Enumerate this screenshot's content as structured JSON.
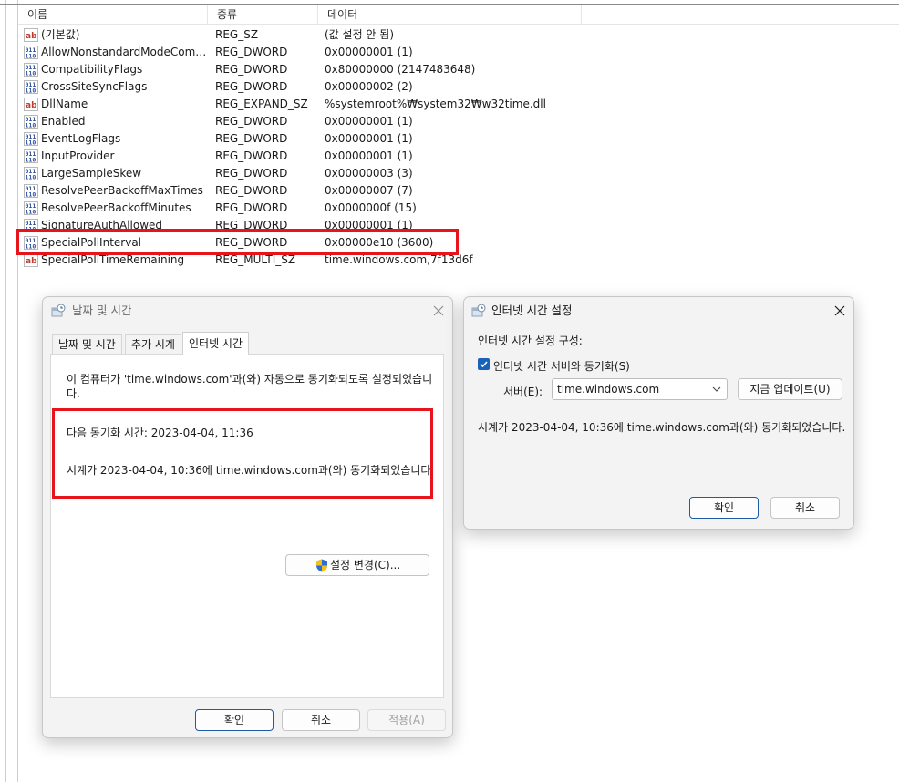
{
  "registry": {
    "columns": {
      "name": "이름",
      "type": "종류",
      "data": "데이터"
    },
    "rows": [
      {
        "icon": "string-value-icon",
        "name": "(기본값)",
        "type": "REG_SZ",
        "data": "(값 설정 안 됨)"
      },
      {
        "icon": "binary-value-icon",
        "name": "AllowNonstandardModeCombin...",
        "type": "REG_DWORD",
        "data": "0x00000001 (1)"
      },
      {
        "icon": "binary-value-icon",
        "name": "CompatibilityFlags",
        "type": "REG_DWORD",
        "data": "0x80000000 (2147483648)"
      },
      {
        "icon": "binary-value-icon",
        "name": "CrossSiteSyncFlags",
        "type": "REG_DWORD",
        "data": "0x00000002 (2)"
      },
      {
        "icon": "string-value-icon",
        "name": "DllName",
        "type": "REG_EXPAND_SZ",
        "data": "%systemroot%₩system32₩w32time.dll"
      },
      {
        "icon": "binary-value-icon",
        "name": "Enabled",
        "type": "REG_DWORD",
        "data": "0x00000001 (1)"
      },
      {
        "icon": "binary-value-icon",
        "name": "EventLogFlags",
        "type": "REG_DWORD",
        "data": "0x00000001 (1)"
      },
      {
        "icon": "binary-value-icon",
        "name": "InputProvider",
        "type": "REG_DWORD",
        "data": "0x00000001 (1)"
      },
      {
        "icon": "binary-value-icon",
        "name": "LargeSampleSkew",
        "type": "REG_DWORD",
        "data": "0x00000003 (3)"
      },
      {
        "icon": "binary-value-icon",
        "name": "ResolvePeerBackoffMaxTimes",
        "type": "REG_DWORD",
        "data": "0x00000007 (7)"
      },
      {
        "icon": "binary-value-icon",
        "name": "ResolvePeerBackoffMinutes",
        "type": "REG_DWORD",
        "data": "0x0000000f (15)"
      },
      {
        "icon": "binary-value-icon",
        "name": "SignatureAuthAllowed",
        "type": "REG_DWORD",
        "data": "0x00000001 (1)"
      },
      {
        "icon": "binary-value-icon",
        "name": "SpecialPollInterval",
        "type": "REG_DWORD",
        "data": "0x00000e10 (3600)"
      },
      {
        "icon": "string-value-icon",
        "name": "SpecialPollTimeRemaining",
        "type": "REG_MULTI_SZ",
        "data": "time.windows.com,7f13d6f"
      }
    ]
  },
  "date_time_dialog": {
    "title": "날짜 및 시간",
    "tabs": [
      "날짜 및 시간",
      "추가 시계",
      "인터넷 시간"
    ],
    "active_tab": "인터넷 시간",
    "message": "이 컴퓨터가 'time.windows.com'과(와) 자동으로 동기화되도록 설정되었습니다.",
    "next_sync": "다음 동기화 시간: 2023-04-04, 11:36",
    "last_sync": "시계가 2023-04-04, 10:36에 time.windows.com과(와) 동기화되었습니다.",
    "change_settings_button": "설정 변경(C)...",
    "ok_button": "확인",
    "cancel_button": "취소",
    "apply_button": "적용(A)"
  },
  "internet_time_dialog": {
    "title": "인터넷 시간 설정",
    "configure_label": "인터넷 시간 설정 구성:",
    "sync_checkbox_label": "인터넷 시간 서버와 동기화(S)",
    "sync_checked": true,
    "server_label": "서버(E):",
    "server_value": "time.windows.com",
    "update_now_button": "지금 업데이트(U)",
    "status": "시계가 2023-04-04, 10:36에 time.windows.com과(와) 동기화되었습니다.",
    "ok_button": "확인",
    "cancel_button": "취소"
  },
  "colors": {
    "highlight": "#e8141b",
    "accent": "#1a62b8"
  }
}
